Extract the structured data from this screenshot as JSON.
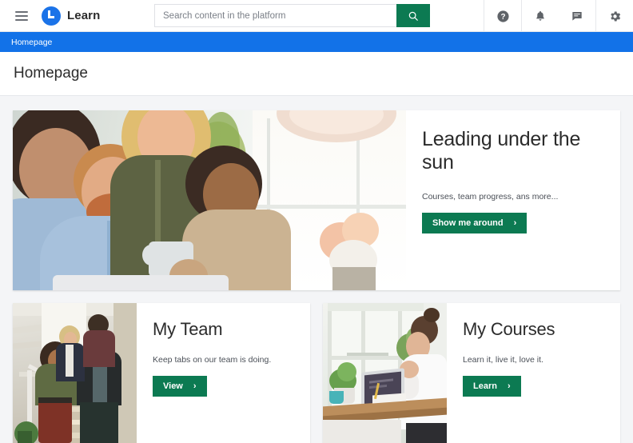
{
  "header": {
    "menu_label": "menu",
    "brand_name": "Learn",
    "brand_color": "#1b73e8",
    "accent_green": "#0c7a52",
    "breadcrumb_blue": "#1272e8",
    "search": {
      "placeholder": "Search content in the platform",
      "value": "",
      "button_icon": "search-icon"
    },
    "icons": [
      {
        "name": "help-icon",
        "label": "Help"
      },
      {
        "name": "bell-icon",
        "label": "Notifications"
      },
      {
        "name": "chat-icon",
        "label": "Messages"
      },
      {
        "name": "gear-icon",
        "label": "Settings"
      }
    ]
  },
  "breadcrumb": {
    "items": [
      "Homepage"
    ]
  },
  "page": {
    "title": "Homepage"
  },
  "hero": {
    "title": "Leading under the sun",
    "subtitle": "Courses, team progress, ans more...",
    "cta_label": "Show me around",
    "cta_chevron": "›",
    "image_alt": "smiling colleagues gathered around a laptop in a bright office"
  },
  "cards": [
    {
      "title": "My Team",
      "subtitle": "Keep tabs on our team is doing.",
      "cta_label": "View",
      "cta_chevron": "›",
      "image_alt": "group of coworkers walking down an office staircase"
    },
    {
      "title": "My Courses",
      "subtitle": "Learn it, live it, love it.",
      "cta_label": "Learn",
      "cta_chevron": "›",
      "image_alt": "woman writing notes beside a laptop at a sunlit desk"
    }
  ]
}
